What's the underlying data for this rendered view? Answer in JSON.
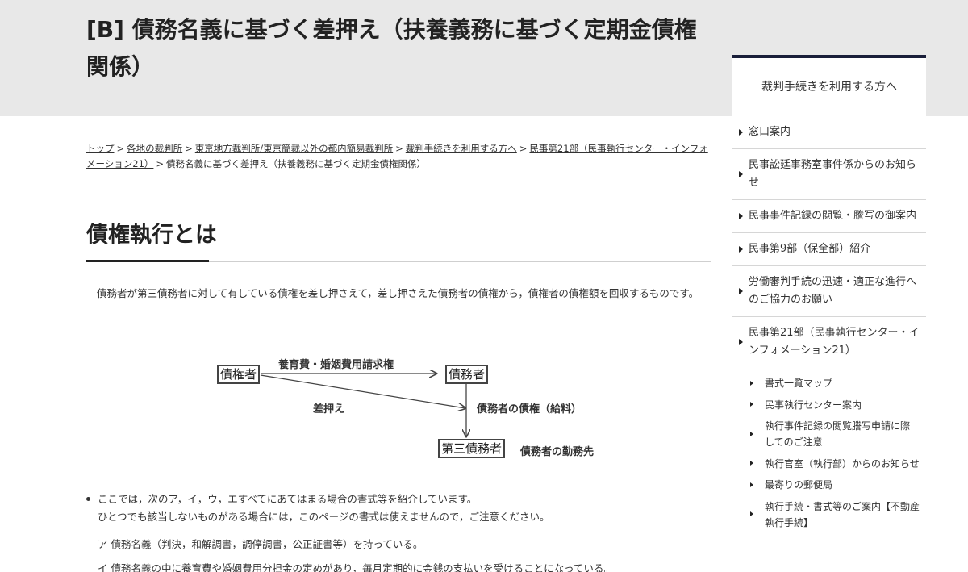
{
  "page": {
    "title": "[B] 債務名義に基づく差押え（扶養義務に基づく定期金債権関係）"
  },
  "breadcrumb": {
    "items": [
      "トップ",
      "各地の裁判所",
      "東京地方裁判所/東京簡裁以外の都内簡易裁判所",
      "裁判手続きを利用する方へ",
      "民事第21部（民事執行センター・インフォメーション21）"
    ],
    "current": "債務名義に基づく差押え（扶養義務に基づく定期金債権関係）",
    "separator": ">"
  },
  "main": {
    "heading": "債権執行とは",
    "intro": "債務者が第三債務者に対して有している債権を差し押さえて，差し押さえた債務者の債権から，債権者の債権額を回収するものです。",
    "diagram": {
      "creditor": "債権者",
      "debtor": "債務者",
      "third_party": "第三債務者",
      "label_claim": "養育費・婚姻費用請求権",
      "label_seizure": "差押え",
      "label_debtor_claim": "債務者の債権（給料）",
      "label_workplace": "債務者の勤務先"
    },
    "bullet": {
      "line1": "ここでは，次のア，イ，ウ，エすべてにあてはまる場合の書式等を紹介しています。",
      "line2": "ひとつでも該当しないものがある場合には，このページの書式は使えませんので，ご注意ください。"
    },
    "condition_a": "ア 債務名義（判決，和解調書，調停調書，公正証書等）を持っている。",
    "condition_b": "イ 債務名義の中に養育費や婚姻費用分担金の定めがあり，毎月定期的に金銭の支払いを受けることになっている。"
  },
  "sidebar": {
    "heading": "裁判手続きを利用する方へ",
    "items": [
      "窓口案内",
      "民事訟廷事務室事件係からのお知らせ",
      "民事事件記録の閲覧・謄写の御案内",
      "民事第9部（保全部）紹介",
      "労働審判手続の迅速・適正な進行へのご協力のお願い",
      "民事第21部（民事執行センター・インフォメーション21）"
    ],
    "subitems": [
      "書式一覧マップ",
      "民事執行センター案内",
      "執行事件記録の閲覧謄写申請に際してのご注意",
      "執行官室（執行部）からのお知らせ",
      "最寄りの郵便局",
      "執行手続・書式等のご案内【不動産執行手続】"
    ]
  }
}
